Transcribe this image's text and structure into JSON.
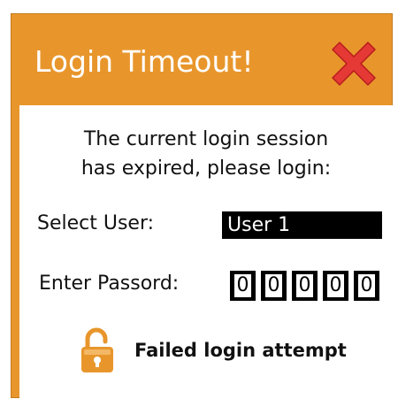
{
  "dialog": {
    "title": "Login Timeout!",
    "close_icon": "close-icon",
    "message_line1": "The current login session",
    "message_line2": "has expired, please login:",
    "select_user_label": "Select User:",
    "selected_user": "User 1",
    "password_label": "Enter Passord:",
    "password_digits": [
      "0",
      "0",
      "0",
      "0",
      "0"
    ],
    "status_icon": "unlocked-padlock-icon",
    "status_text": "Failed login attempt"
  },
  "colors": {
    "titlebar": "#e8962c",
    "close": "#e53935",
    "lock": "#e8962c"
  }
}
